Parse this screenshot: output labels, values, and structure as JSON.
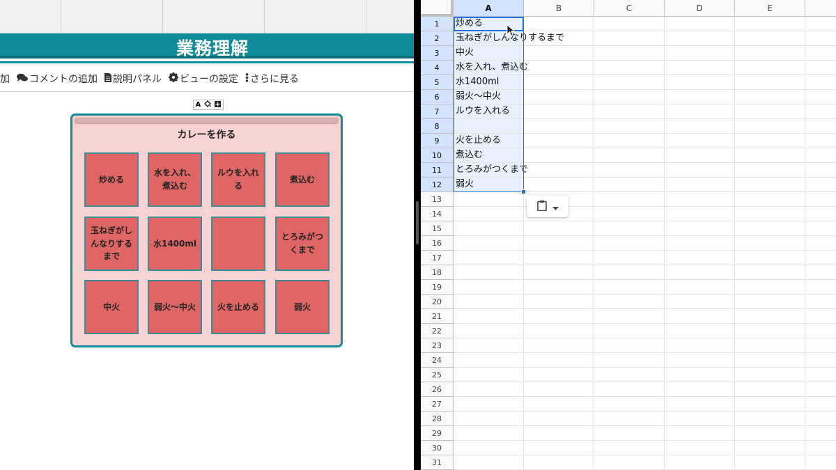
{
  "left": {
    "title": "業務理解",
    "toolbar": [
      {
        "label": "加",
        "icon": "plus-icon"
      },
      {
        "label": "コメントの追加",
        "icon": "comments-icon"
      },
      {
        "label": "説明パネル",
        "icon": "document-icon"
      },
      {
        "label": "ビューの設定",
        "icon": "gear-icon"
      },
      {
        "label": "さらに見る",
        "icon": "more-vertical-icon"
      }
    ],
    "mini_tools": [
      "A",
      "paint-bucket-icon",
      "plus-box-icon"
    ],
    "board": {
      "title": "カレーを作る",
      "cards": [
        [
          "炒める",
          "水を入れ、煮込む",
          "ルウを入れる",
          "煮込む"
        ],
        [
          "玉ねぎがしんなりするまで",
          "水1400ml",
          "",
          "とろみがつくまで"
        ],
        [
          "中火",
          "弱火〜中火",
          "火を止める",
          "弱火"
        ]
      ]
    }
  },
  "sheet": {
    "columns": [
      "A",
      "B",
      "C",
      "D",
      "E"
    ],
    "selected_column": "A",
    "rows": [
      "1",
      "2",
      "3",
      "4",
      "5",
      "6",
      "7",
      "8",
      "9",
      "10",
      "11",
      "12",
      "13",
      "14",
      "15",
      "16",
      "17",
      "18",
      "19",
      "20",
      "21",
      "22",
      "23",
      "24",
      "25",
      "26",
      "27",
      "28",
      "29",
      "30",
      "31"
    ],
    "column_a_values": [
      "炒める",
      "玉ねぎがしんなりするまで",
      "中火",
      "水を入れ、煮込む",
      "水1400ml",
      "弱火〜中火",
      "ルウを入れる",
      "",
      "火を止める",
      "煮込む",
      "とろみがつくまで",
      "弱火"
    ],
    "selection_color": "#1a73e8",
    "paste_button_icon": "clipboard-icon"
  }
}
